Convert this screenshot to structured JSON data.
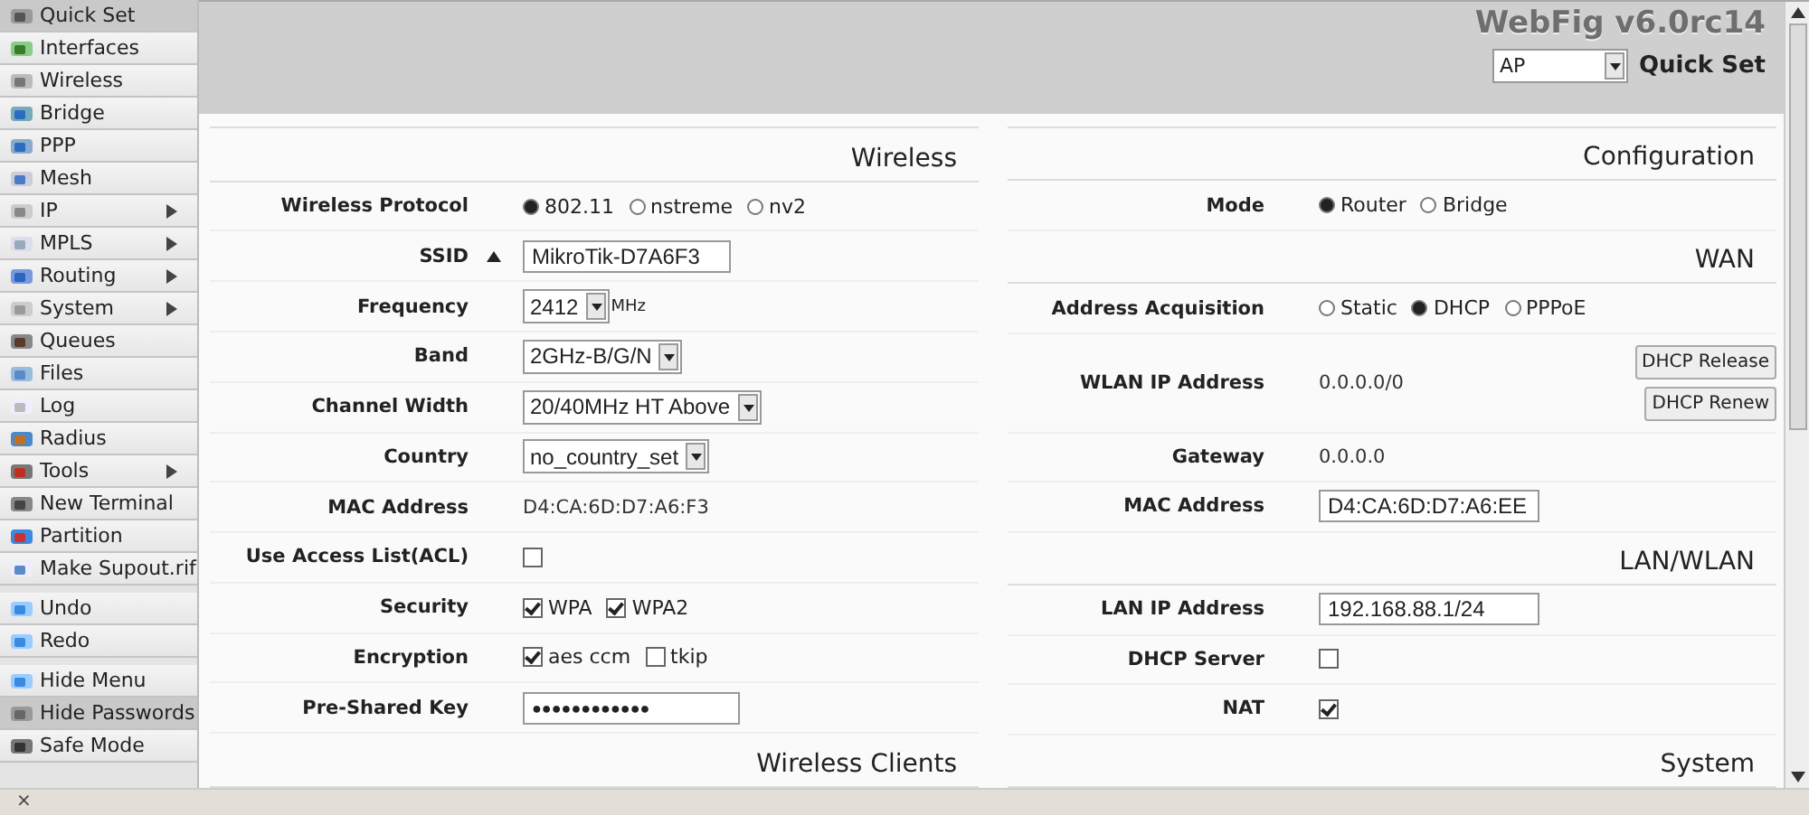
{
  "sidebar": {
    "groups": [
      {
        "items": [
          {
            "label": "Quick Set",
            "selected": true,
            "has_submenu": false
          },
          {
            "label": "Interfaces",
            "selected": false,
            "has_submenu": false
          },
          {
            "label": "Wireless",
            "selected": false,
            "has_submenu": false
          },
          {
            "label": "Bridge",
            "selected": false,
            "has_submenu": false
          },
          {
            "label": "PPP",
            "selected": false,
            "has_submenu": false
          },
          {
            "label": "Mesh",
            "selected": false,
            "has_submenu": false
          },
          {
            "label": "IP",
            "selected": false,
            "has_submenu": true
          },
          {
            "label": "MPLS",
            "selected": false,
            "has_submenu": true
          },
          {
            "label": "Routing",
            "selected": false,
            "has_submenu": true
          },
          {
            "label": "System",
            "selected": false,
            "has_submenu": true
          },
          {
            "label": "Queues",
            "selected": false,
            "has_submenu": false
          },
          {
            "label": "Files",
            "selected": false,
            "has_submenu": false
          },
          {
            "label": "Log",
            "selected": false,
            "has_submenu": false
          },
          {
            "label": "Radius",
            "selected": false,
            "has_submenu": false
          },
          {
            "label": "Tools",
            "selected": false,
            "has_submenu": true
          },
          {
            "label": "New Terminal",
            "selected": false,
            "has_submenu": false
          },
          {
            "label": "Partition",
            "selected": false,
            "has_submenu": false
          },
          {
            "label": "Make Supout.rif",
            "selected": false,
            "has_submenu": false
          }
        ]
      },
      {
        "items": [
          {
            "label": "Undo",
            "selected": false,
            "has_submenu": false
          },
          {
            "label": "Redo",
            "selected": false,
            "has_submenu": false
          }
        ]
      },
      {
        "items": [
          {
            "label": "Hide Menu",
            "selected": false,
            "has_submenu": false
          },
          {
            "label": "Hide Passwords",
            "selected": true,
            "has_submenu": false
          },
          {
            "label": "Safe Mode",
            "selected": false,
            "has_submenu": false
          }
        ]
      }
    ]
  },
  "header": {
    "title": "WebFig v6.0rc14",
    "mode_select": "AP",
    "page_title": "Quick Set"
  },
  "columns": [
    {
      "items": [
        {
          "kind": "section",
          "title": "Wireless"
        },
        {
          "kind": "radio",
          "label": "Wireless Protocol",
          "options": [
            {
              "label": "802.11",
              "selected": true
            },
            {
              "label": "nstreme",
              "selected": false
            },
            {
              "label": "nv2",
              "selected": false
            }
          ]
        },
        {
          "kind": "input",
          "label": "SSID",
          "value": "MikroTik-D7A6F3",
          "expander": true
        },
        {
          "kind": "select",
          "label": "Frequency",
          "value": "2412",
          "unit": "MHz"
        },
        {
          "kind": "select",
          "label": "Band",
          "value": "2GHz-B/G/N"
        },
        {
          "kind": "select",
          "label": "Channel Width",
          "value": "20/40MHz HT Above"
        },
        {
          "kind": "select",
          "label": "Country",
          "value": "no_country_set"
        },
        {
          "kind": "text",
          "label": "MAC Address",
          "value": "D4:CA:6D:D7:A6:F3"
        },
        {
          "kind": "checks",
          "label": "Use Access List(ACL)",
          "options": [
            {
              "checked": false
            }
          ]
        },
        {
          "kind": "checks",
          "label": "Security",
          "options": [
            {
              "label": "WPA",
              "checked": true
            },
            {
              "label": "WPA2",
              "checked": true
            }
          ]
        },
        {
          "kind": "checks",
          "label": "Encryption",
          "options": [
            {
              "label": "aes ccm",
              "checked": true
            },
            {
              "label": "tkip",
              "checked": false
            }
          ]
        },
        {
          "kind": "password",
          "label": "Pre-Shared Key",
          "value": "●●●●●●●●●●●●"
        },
        {
          "kind": "section",
          "title": "Wireless Clients"
        }
      ]
    },
    {
      "items": [
        {
          "kind": "section",
          "title": "Configuration"
        },
        {
          "kind": "radio",
          "label": "Mode",
          "options": [
            {
              "label": "Router",
              "selected": true
            },
            {
              "label": "Bridge",
              "selected": false
            }
          ]
        },
        {
          "kind": "section",
          "title": "WAN"
        },
        {
          "kind": "radio",
          "label": "Address Acquisition",
          "options": [
            {
              "label": "Static",
              "selected": false
            },
            {
              "label": "DHCP",
              "selected": true
            },
            {
              "label": "PPPoE",
              "selected": false
            }
          ]
        },
        {
          "kind": "text",
          "label": "WLAN IP Address",
          "value": "0.0.0.0/0",
          "buttons": [
            "DHCP Release",
            "DHCP Renew"
          ]
        },
        {
          "kind": "text",
          "label": "Gateway",
          "value": "0.0.0.0"
        },
        {
          "kind": "input",
          "label": "MAC Address",
          "value": "D4:CA:6D:D7:A6:EE"
        },
        {
          "kind": "section",
          "title": "LAN/WLAN"
        },
        {
          "kind": "input",
          "label": "LAN IP Address",
          "value": "192.168.88.1/24"
        },
        {
          "kind": "checks",
          "label": "DHCP Server",
          "options": [
            {
              "checked": false
            }
          ]
        },
        {
          "kind": "checks",
          "label": "NAT",
          "options": [
            {
              "checked": true
            }
          ]
        },
        {
          "kind": "section",
          "title": "System"
        }
      ]
    }
  ],
  "status_bar": {
    "close": "×"
  }
}
